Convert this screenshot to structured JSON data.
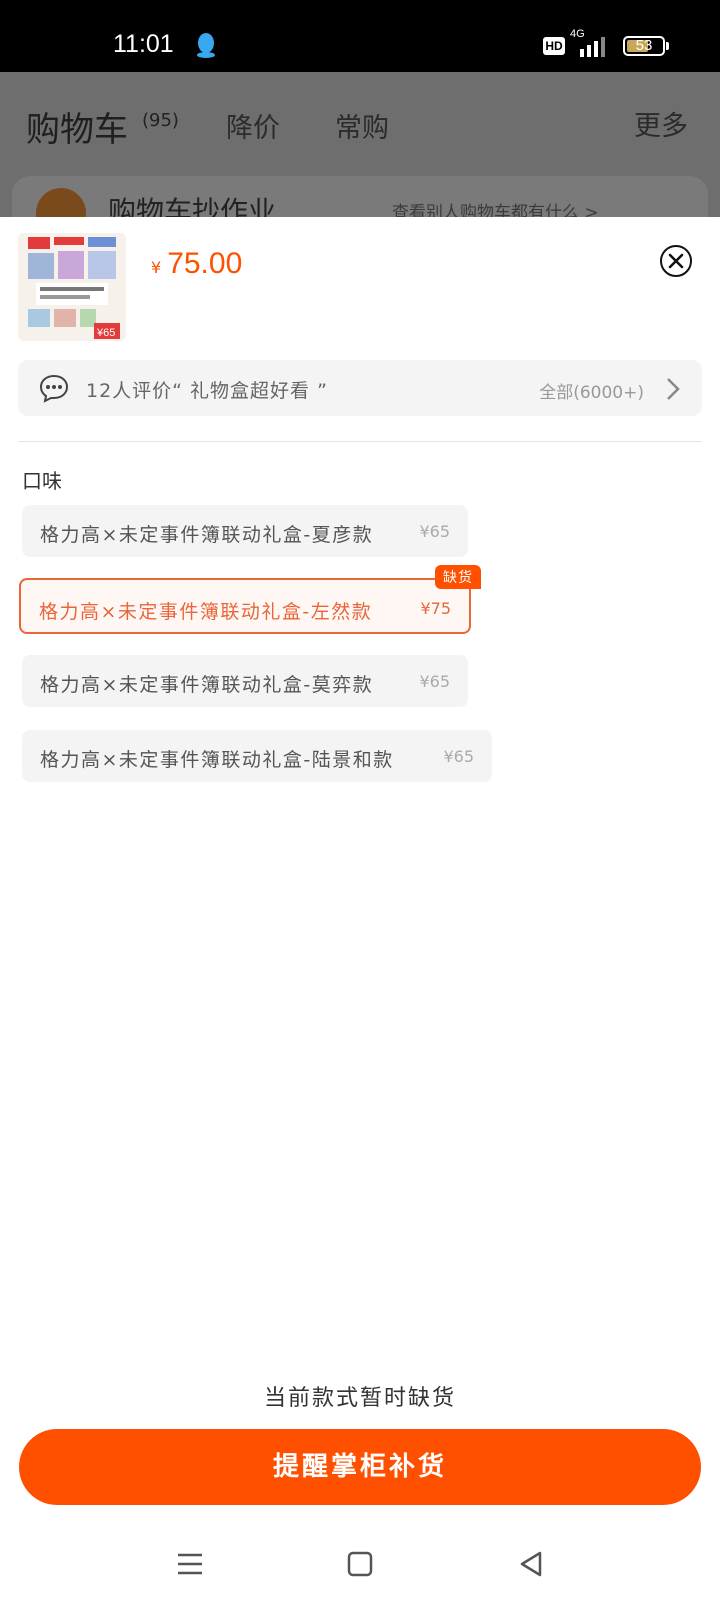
{
  "status_bar": {
    "time": "11:01",
    "hd": "HD",
    "network": "4G",
    "battery": "53"
  },
  "background_page": {
    "tabs": [
      "购物车",
      "降价",
      "常购",
      "更多"
    ],
    "cart_count": "(95)",
    "banner_title": "购物车抄作业",
    "banner_right": "查看别人购物车都有什么 >"
  },
  "product": {
    "price_currency": "¥",
    "price_value": "75.00",
    "thumbnail_badge": "¥65"
  },
  "review_bar": {
    "text": "12人评价“ 礼物盒超好看 ”",
    "all": "全部(6000+)"
  },
  "section_title": "口味",
  "options": [
    {
      "name": "格力高×未定事件簿联动礼盒-夏彦款",
      "price": "¥65",
      "selected": false
    },
    {
      "name": "格力高×未定事件簿联动礼盒-左然款",
      "price": "¥75",
      "selected": true,
      "tag": "缺货"
    },
    {
      "name": "格力高×未定事件簿联动礼盒-莫弈款",
      "price": "¥65",
      "selected": false
    },
    {
      "name": "格力高×未定事件簿联动礼盒-陆景和款",
      "price": "¥65",
      "selected": false
    }
  ],
  "footer": {
    "hint": "当前款式暂时缺货",
    "button": "提醒掌柜补货"
  },
  "colors": {
    "accent": "#ff5000",
    "selected_border": "#e8663a"
  },
  "icons": [
    "qq-icon",
    "signal-icon",
    "battery-icon",
    "close-icon",
    "comment-icon",
    "chevron-right-icon",
    "menu-icon",
    "home-icon",
    "back-icon"
  ]
}
